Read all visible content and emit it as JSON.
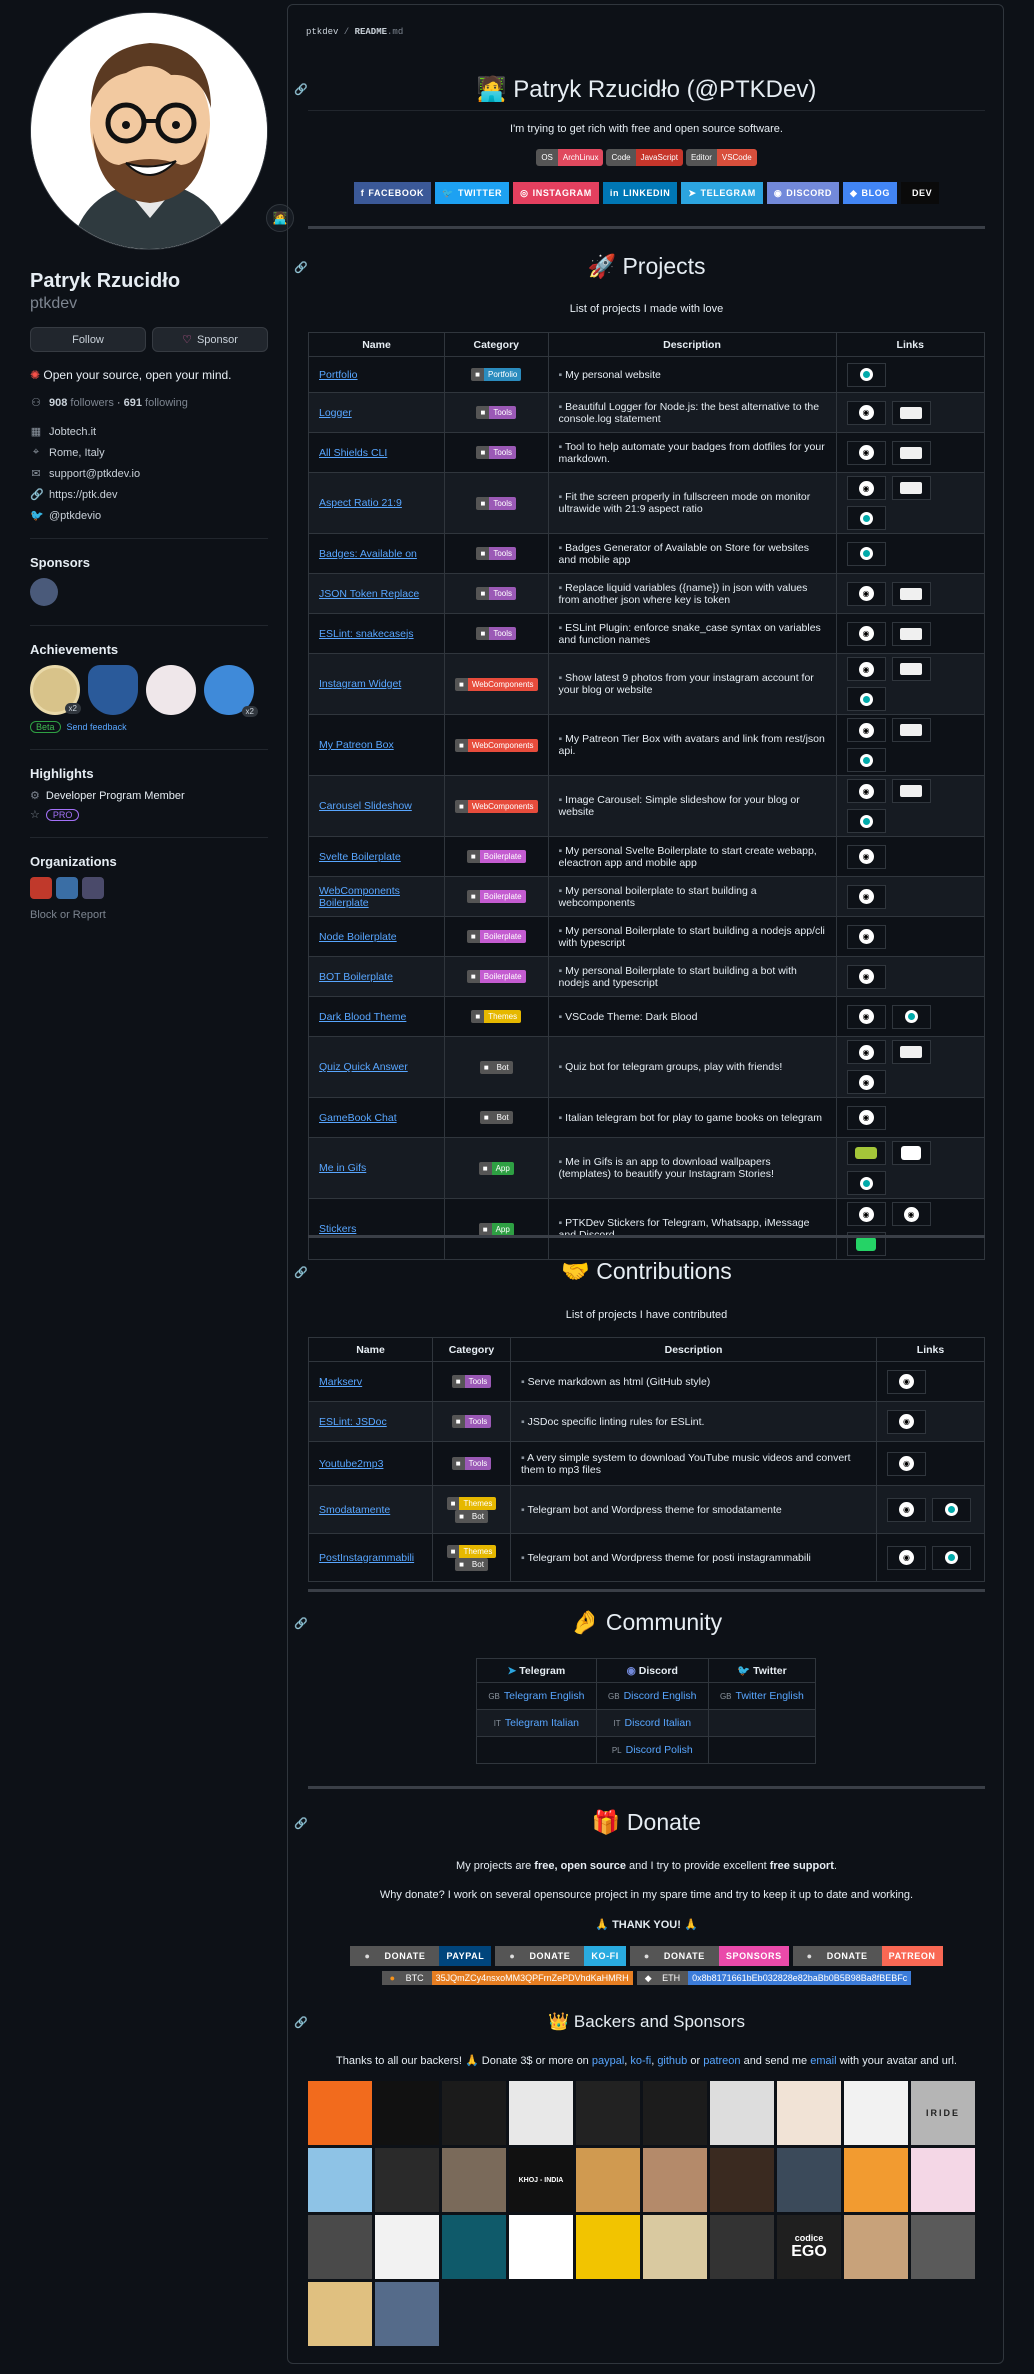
{
  "profile": {
    "name": "Patryk Rzucidło",
    "username": "ptkdev",
    "follow_label": "Follow",
    "sponsor_label": "Sponsor",
    "bio": "Open your source, open your mind.",
    "followers_count": "908",
    "followers_label": "followers",
    "following_count": "691",
    "following_label": "following",
    "company": "Jobtech.it",
    "location": "Rome, Italy",
    "email": "support@ptkdev.io",
    "website": "https://ptk.dev",
    "twitter": "@ptkdevio"
  },
  "sidebar": {
    "sponsors_title": "Sponsors",
    "achievements_title": "Achievements",
    "achievement_counts": [
      "x2",
      "x2"
    ],
    "beta_label": "Beta",
    "feedback_label": "Send feedback",
    "highlights_title": "Highlights",
    "highlight_item": "Developer Program Member",
    "pro_label": "PRO",
    "organizations_title": "Organizations",
    "block_label": "Block or Report"
  },
  "readme": {
    "breadcrumb_user": "ptkdev",
    "breadcrumb_sep": " / ",
    "breadcrumb_file": "README",
    "breadcrumb_ext": ".md",
    "title": "Patryk Rzucidło (@PTKDev)",
    "subtitle": "I'm trying to get rich with free and open source software.",
    "info_badges": [
      {
        "label": "OS",
        "value": "ArchLinux"
      },
      {
        "label": "Code",
        "value": "JavaScript"
      },
      {
        "label": "Editor",
        "value": "VSCode"
      }
    ],
    "social": [
      {
        "label": "FACEBOOK",
        "color": "#3b5998"
      },
      {
        "label": "TWITTER",
        "color": "#1da1f2"
      },
      {
        "label": "INSTAGRAM",
        "color": "#e4405f"
      },
      {
        "label": "LINKEDIN",
        "color": "#0077b5"
      },
      {
        "label": "TELEGRAM",
        "color": "#2ca5e0"
      },
      {
        "label": "DISCORD",
        "color": "#7289da"
      },
      {
        "label": "BLOG",
        "color": "#4285f4"
      },
      {
        "label": "DEV",
        "color": "#0a0a0a"
      }
    ]
  },
  "projects": {
    "title": "Projects",
    "subtitle": "List of projects I made with love",
    "headers": [
      "Name",
      "Category",
      "Description",
      "Links"
    ],
    "rows": [
      {
        "name": "Portfolio",
        "cat": "Portfolio",
        "catcolor": "#2b8cbe",
        "desc": "My personal website",
        "links": [
          "t"
        ]
      },
      {
        "name": "Logger",
        "cat": "Tools",
        "catcolor": "#9b59b6",
        "desc": "Beautiful Logger for Node.js: the best alternative to the console.log statement",
        "links": [
          "gh",
          "w"
        ]
      },
      {
        "name": "All Shields CLI",
        "cat": "Tools",
        "catcolor": "#9b59b6",
        "desc": "Tool to help automate your badges from dotfiles for your markdown.",
        "links": [
          "gh",
          "w"
        ]
      },
      {
        "name": "Aspect Ratio 21:9",
        "cat": "Tools",
        "catcolor": "#9b59b6",
        "desc": "Fit the screen properly in fullscreen mode on monitor ultrawide with 21:9 aspect ratio",
        "links": [
          "gh",
          "w",
          "t"
        ]
      },
      {
        "name": "Badges: Available on",
        "cat": "Tools",
        "catcolor": "#9b59b6",
        "desc": "Badges Generator of Available on Store for websites and mobile app",
        "links": [
          "t"
        ]
      },
      {
        "name": "JSON Token Replace",
        "cat": "Tools",
        "catcolor": "#9b59b6",
        "desc": "Replace liquid variables ({name}) in json with values from another json where key is token",
        "links": [
          "gh",
          "w"
        ]
      },
      {
        "name": "ESLint: snakecasejs",
        "cat": "Tools",
        "catcolor": "#9b59b6",
        "desc": "ESLint Plugin: enforce snake_case syntax on variables and function names",
        "links": [
          "gh",
          "w"
        ]
      },
      {
        "name": "Instagram Widget",
        "cat": "WebComponents",
        "catcolor": "#e74c3c",
        "desc": "Show latest 9 photos from your instagram account for your blog or website",
        "links": [
          "gh",
          "w",
          "t"
        ]
      },
      {
        "name": "My Patreon Box",
        "cat": "WebComponents",
        "catcolor": "#e74c3c",
        "desc": "My Patreon Tier Box with avatars and link from rest/json api.",
        "links": [
          "gh",
          "w",
          "t"
        ]
      },
      {
        "name": "Carousel Slideshow",
        "cat": "WebComponents",
        "catcolor": "#e74c3c",
        "desc": "Image Carousel: Simple slideshow for your blog or website",
        "links": [
          "gh",
          "w",
          "t"
        ]
      },
      {
        "name": "Svelte Boilerplate",
        "cat": "Boilerplate",
        "catcolor": "#c45cd1",
        "desc": "My personal Svelte Boilerplate to start create webapp, eleactron app and mobile app",
        "links": [
          "gh"
        ]
      },
      {
        "name": "WebComponents Boilerplate",
        "cat": "Boilerplate",
        "catcolor": "#c45cd1",
        "desc": "My personal boilerplate to start building a webcomponents",
        "links": [
          "gh"
        ]
      },
      {
        "name": "Node Boilerplate",
        "cat": "Boilerplate",
        "catcolor": "#c45cd1",
        "desc": "My personal Boilerplate to start building a nodejs app/cli with typescript",
        "links": [
          "gh"
        ]
      },
      {
        "name": "BOT Boilerplate",
        "cat": "Boilerplate",
        "catcolor": "#c45cd1",
        "desc": "My personal Boilerplate to start building a bot with nodejs and typescript",
        "links": [
          "gh"
        ]
      },
      {
        "name": "Dark Blood Theme",
        "cat": "Themes",
        "catcolor": "#e6b800",
        "desc": "VSCode Theme: Dark Blood",
        "links": [
          "gh",
          "t"
        ]
      },
      {
        "name": "Quiz Quick Answer",
        "cat": "Bot",
        "catcolor": "#555",
        "desc": "Quiz bot for telegram groups, play with friends!",
        "links": [
          "gh",
          "w",
          "gh"
        ]
      },
      {
        "name": "GameBook Chat",
        "cat": "Bot",
        "catcolor": "#555",
        "desc": "Italian telegram bot for play to game books on telegram",
        "links": [
          "gh"
        ]
      },
      {
        "name": "Me in Gifs",
        "cat": "App",
        "catcolor": "#2ea043",
        "desc": "Me in Gifs is an app to download wallpapers (templates) to beautify your Instagram Stories!",
        "links": [
          "and",
          "apple",
          "t"
        ]
      },
      {
        "name": "Stickers",
        "cat": "App",
        "catcolor": "#2ea043",
        "desc": "PTKDev Stickers for Telegram, Whatsapp, iMessage and Discord",
        "links": [
          "gh",
          "gh",
          "wa"
        ]
      }
    ]
  },
  "contributions": {
    "title": "Contributions",
    "subtitle": "List of projects I have contributed",
    "headers": [
      "Name",
      "Category",
      "Description",
      "Links"
    ],
    "rows": [
      {
        "name": "Markserv",
        "cats": [
          [
            "Tools",
            "#9b59b6"
          ]
        ],
        "desc": "Serve markdown as html (GitHub style)",
        "links": [
          "gh"
        ]
      },
      {
        "name": "ESLint: JSDoc",
        "cats": [
          [
            "Tools",
            "#9b59b6"
          ]
        ],
        "desc": "JSDoc specific linting rules for ESLint.",
        "links": [
          "gh"
        ]
      },
      {
        "name": "Youtube2mp3",
        "cats": [
          [
            "Tools",
            "#9b59b6"
          ]
        ],
        "desc": "A very simple system to download YouTube music videos and convert them to mp3 files",
        "links": [
          "gh"
        ]
      },
      {
        "name": "Smodatamente",
        "cats": [
          [
            "Themes",
            "#e6b800"
          ],
          [
            "Bot",
            "#555"
          ]
        ],
        "desc": "Telegram bot and Wordpress theme for smodatamente",
        "links": [
          "gh",
          "t"
        ]
      },
      {
        "name": "PostInstagrammabili",
        "cats": [
          [
            "Themes",
            "#e6b800"
          ],
          [
            "Bot",
            "#555"
          ]
        ],
        "desc": "Telegram bot and Wordpress theme for posti instagrammabili",
        "links": [
          "gh",
          "t"
        ]
      }
    ]
  },
  "community": {
    "title": "Community",
    "headers": [
      "Telegram",
      "Discord",
      "Twitter"
    ],
    "rows": [
      [
        "Telegram English",
        "Discord English",
        "Twitter English"
      ],
      [
        "Telegram Italian",
        "Discord Italian",
        ""
      ],
      [
        "",
        "Discord Polish",
        ""
      ]
    ],
    "flags": [
      [
        "GB",
        "GB",
        "GB"
      ],
      [
        "IT",
        "IT",
        ""
      ],
      [
        "",
        "PL",
        ""
      ]
    ]
  },
  "donate": {
    "title": "Donate",
    "line1_a": "My projects are ",
    "line1_b": "free, open source",
    "line1_c": " and I try to provide excellent ",
    "line1_d": "free support",
    "line1_e": ".",
    "line2": "Why donate? I work on several opensource project in my spare time and try to keep it up to date and working.",
    "thanks": "THANK YOU!",
    "badges": [
      {
        "label": "DONATE",
        "value": "PAYPAL",
        "color": "#00457c"
      },
      {
        "label": "DONATE",
        "value": "KO-FI",
        "color": "#29abe0"
      },
      {
        "label": "DONATE",
        "value": "SPONSORS",
        "color": "#ea4aaa"
      },
      {
        "label": "DONATE",
        "value": "PATREON",
        "color": "#f96854"
      }
    ],
    "btc_label": "BTC",
    "btc_value": "35JQmZCy4nsxoMM3QPFrnZePDVhdKaHMRH",
    "eth_label": "ETH",
    "eth_value": "0x8b8171661bEb032828e82baBb0B5B98Ba8fBEBFc"
  },
  "backers": {
    "title": "Backers and Sponsors",
    "text_a": "Thanks to all our backers! ",
    "text_b": " Donate 3$ or more on ",
    "paypal": "paypal",
    "sep1": ", ",
    "kofi": "ko-fi",
    "sep2": ", ",
    "github": "github",
    "sep3": " or ",
    "patreon": "patreon",
    "text_c": " and send me ",
    "email": "email",
    "text_d": " with your avatar and url.",
    "iride": "IRIDE",
    "codice": "codice",
    "ego": "EGO",
    "khoj": "KHOJ - INDIA",
    "avatars": [
      "#f26b1d",
      "#111",
      "#1b1b1b",
      "#e8e8e8",
      "#222",
      "#1c1c1c",
      "#ddd",
      "#f1e3d6",
      "#f2f2f2",
      "#b5b5b5",
      "#8ec3e6",
      "#2a2a2a",
      "#7a6a5a",
      "#111",
      "#d09a50",
      "#b48a6a",
      "#3a2a20",
      "#3b4a5a",
      "#f29b30",
      "#f4d7e6",
      "#4a4a4a",
      "#f2f2f2",
      "#0f5a6a",
      "#fff",
      "#f2c400",
      "#d9c9a0",
      "#333",
      "#1f1f1f",
      "#c8a27a",
      "#5a5a5a",
      "#e0c080",
      "#556b8a"
    ]
  }
}
